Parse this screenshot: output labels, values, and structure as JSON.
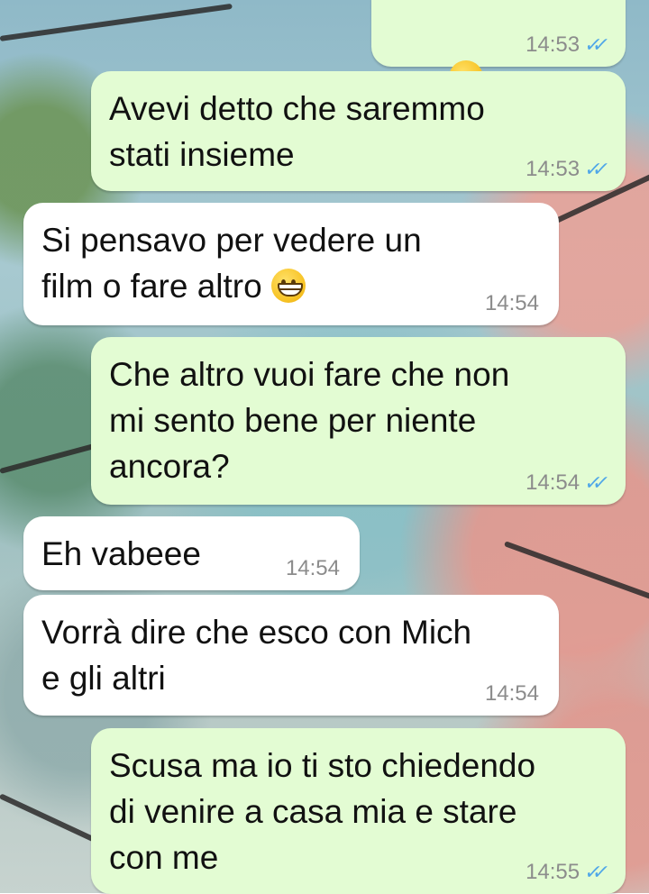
{
  "messages": [
    {
      "id": "m1",
      "direction": "outgoing",
      "text": "",
      "emoji": [
        "frown",
        "frown"
      ],
      "time": "14:53",
      "status": "read"
    },
    {
      "id": "m2",
      "direction": "outgoing",
      "text": "Avevi detto che saremmo\nstati insieme",
      "time": "14:53",
      "status": "read"
    },
    {
      "id": "m3",
      "direction": "incoming",
      "text": "Si pensavo per vedere un\nfilm o fare altro ",
      "emoji": [
        "grin"
      ],
      "time": "14:54"
    },
    {
      "id": "m4",
      "direction": "outgoing",
      "text": "Che altro vuoi fare che non\nmi sento bene per niente\nancora?",
      "time": "14:54",
      "status": "read"
    },
    {
      "id": "m5",
      "direction": "incoming",
      "text": "Eh vabeee",
      "time": "14:54"
    },
    {
      "id": "m6",
      "direction": "incoming",
      "text": "Vorrà dire che esco con Mich\ne gli altri",
      "time": "14:54"
    },
    {
      "id": "m7",
      "direction": "outgoing",
      "text": "Scusa ma io ti sto chiedendo\ndi venire a casa mia e stare\ncon me",
      "time": "14:55",
      "status": "read"
    }
  ],
  "icons": {
    "read_receipt": "double-check-icon",
    "frown_emoji": "frowning-face-icon",
    "grin_emoji": "grinning-face-icon"
  },
  "colors": {
    "incoming_bubble": "#ffffff",
    "outgoing_bubble": "#e3fcd3",
    "read_tick": "#4fa6e8",
    "timestamp": "#8c8c8c"
  }
}
